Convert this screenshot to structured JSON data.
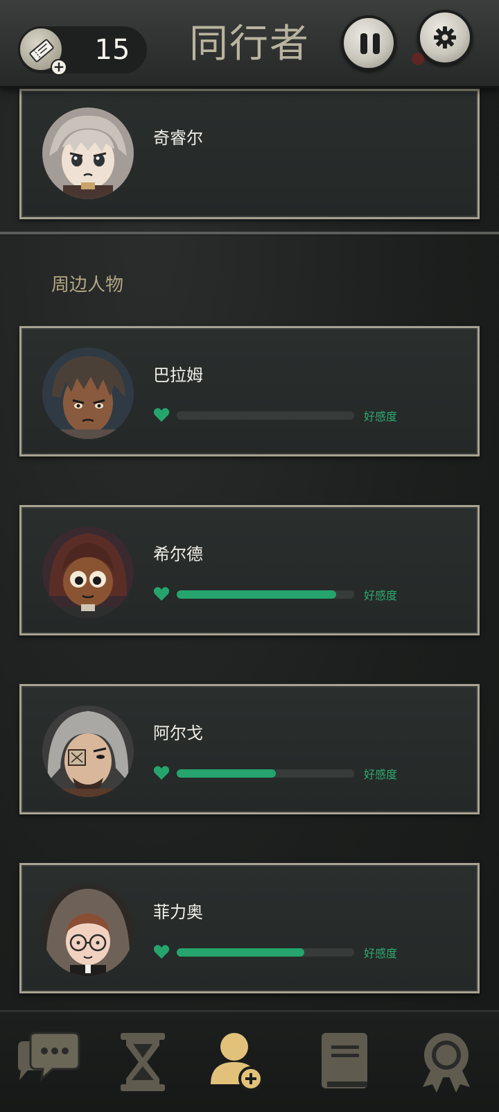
{
  "header": {
    "ticket_count": "15",
    "title": "同行者",
    "icons": {
      "ticket": "ticket-icon",
      "pause": "pause-icon",
      "settings": "gear-icon"
    }
  },
  "companion": {
    "name": "奇睿尔"
  },
  "section": {
    "title": "周边人物"
  },
  "characters": [
    {
      "name": "巴拉姆",
      "affinity_label": "好感度",
      "affinity": 0.0
    },
    {
      "name": "希尔德",
      "affinity_label": "好感度",
      "affinity": 0.9
    },
    {
      "name": "阿尔戈",
      "affinity_label": "好感度",
      "affinity": 0.56
    },
    {
      "name": "菲力奥",
      "affinity_label": "好感度",
      "affinity": 0.72
    }
  ],
  "colors": {
    "affinity": "#25a56d",
    "accent_gold": "#e2c27a",
    "card_border": "#a8a392"
  },
  "bottom_nav": [
    {
      "icon": "chat-icon",
      "active": false
    },
    {
      "icon": "hourglass-icon",
      "active": false
    },
    {
      "icon": "add-person-icon",
      "active": true
    },
    {
      "icon": "book-icon",
      "active": false
    },
    {
      "icon": "award-icon",
      "active": false
    }
  ]
}
